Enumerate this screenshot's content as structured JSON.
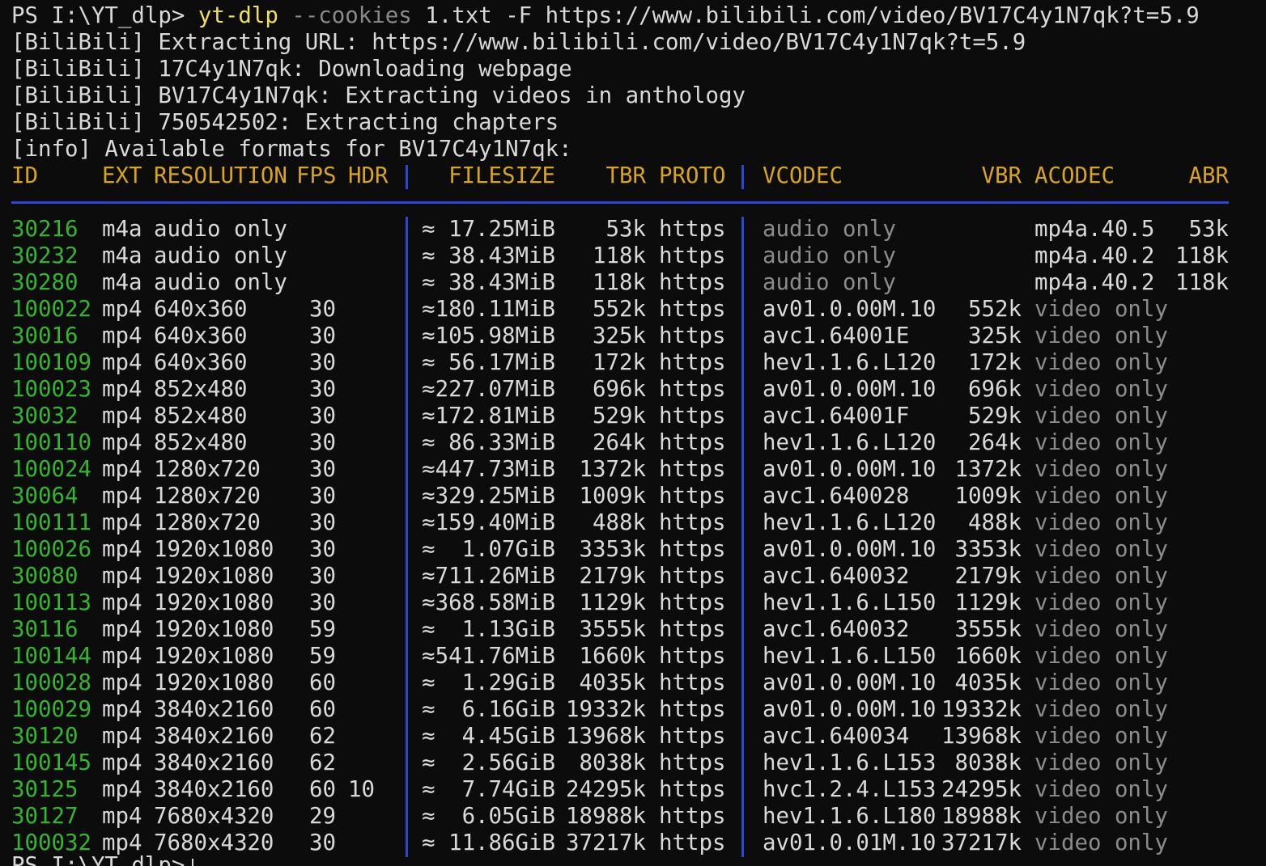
{
  "terminal": {
    "prompt": "PS I:\\YT_dlp> ",
    "command_name": "yt-dlp",
    "command_flag": "--cookies",
    "command_args": "1.txt -F https://www.bilibili.com/video/BV17C4y1N7qk?t=5.9",
    "log_lines": [
      "[BiliBili] Extracting URL: https://www.bilibili.com/video/BV17C4y1N7qk?t=5.9",
      "[BiliBili] 17C4y1N7qk: Downloading webpage",
      "[BiliBili] BV17C4y1N7qk: Extracting videos in anthology",
      "[BiliBili] 750542502: Extracting chapters",
      "[info] Available formats for BV17C4y1N7qk:"
    ],
    "next_prompt": "PS I:\\YT_dlp> "
  },
  "table": {
    "headers": {
      "id": "ID",
      "ext": "EXT",
      "res": "RESOLUTION",
      "fps": "FPS",
      "hdr": "HDR",
      "filesize": "FILESIZE",
      "tbr": "TBR",
      "proto": "PROTO",
      "vcodec": "VCODEC",
      "vbr": "VBR",
      "acodec": "ACODEC",
      "abr": "ABR"
    },
    "rows": [
      {
        "id": "30216",
        "ext": "m4a",
        "res": "audio only",
        "fps": "",
        "hdr": "",
        "size": "≈ 17.25MiB",
        "tbr": "53k",
        "proto": "https",
        "vcodec": "audio only",
        "vbr": "",
        "acodec": "mp4a.40.5",
        "abr": "53k"
      },
      {
        "id": "30232",
        "ext": "m4a",
        "res": "audio only",
        "fps": "",
        "hdr": "",
        "size": "≈ 38.43MiB",
        "tbr": "118k",
        "proto": "https",
        "vcodec": "audio only",
        "vbr": "",
        "acodec": "mp4a.40.2",
        "abr": "118k"
      },
      {
        "id": "30280",
        "ext": "m4a",
        "res": "audio only",
        "fps": "",
        "hdr": "",
        "size": "≈ 38.43MiB",
        "tbr": "118k",
        "proto": "https",
        "vcodec": "audio only",
        "vbr": "",
        "acodec": "mp4a.40.2",
        "abr": "118k"
      },
      {
        "id": "100022",
        "ext": "mp4",
        "res": "640x360",
        "fps": "30",
        "hdr": "",
        "size": "≈180.11MiB",
        "tbr": "552k",
        "proto": "https",
        "vcodec": "av01.0.00M.10",
        "vbr": "552k",
        "acodec": "video only",
        "abr": ""
      },
      {
        "id": "30016",
        "ext": "mp4",
        "res": "640x360",
        "fps": "30",
        "hdr": "",
        "size": "≈105.98MiB",
        "tbr": "325k",
        "proto": "https",
        "vcodec": "avc1.64001E",
        "vbr": "325k",
        "acodec": "video only",
        "abr": ""
      },
      {
        "id": "100109",
        "ext": "mp4",
        "res": "640x360",
        "fps": "30",
        "hdr": "",
        "size": "≈ 56.17MiB",
        "tbr": "172k",
        "proto": "https",
        "vcodec": "hev1.1.6.L120",
        "vbr": "172k",
        "acodec": "video only",
        "abr": ""
      },
      {
        "id": "100023",
        "ext": "mp4",
        "res": "852x480",
        "fps": "30",
        "hdr": "",
        "size": "≈227.07MiB",
        "tbr": "696k",
        "proto": "https",
        "vcodec": "av01.0.00M.10",
        "vbr": "696k",
        "acodec": "video only",
        "abr": ""
      },
      {
        "id": "30032",
        "ext": "mp4",
        "res": "852x480",
        "fps": "30",
        "hdr": "",
        "size": "≈172.81MiB",
        "tbr": "529k",
        "proto": "https",
        "vcodec": "avc1.64001F",
        "vbr": "529k",
        "acodec": "video only",
        "abr": ""
      },
      {
        "id": "100110",
        "ext": "mp4",
        "res": "852x480",
        "fps": "30",
        "hdr": "",
        "size": "≈ 86.33MiB",
        "tbr": "264k",
        "proto": "https",
        "vcodec": "hev1.1.6.L120",
        "vbr": "264k",
        "acodec": "video only",
        "abr": ""
      },
      {
        "id": "100024",
        "ext": "mp4",
        "res": "1280x720",
        "fps": "30",
        "hdr": "",
        "size": "≈447.73MiB",
        "tbr": "1372k",
        "proto": "https",
        "vcodec": "av01.0.00M.10",
        "vbr": "1372k",
        "acodec": "video only",
        "abr": ""
      },
      {
        "id": "30064",
        "ext": "mp4",
        "res": "1280x720",
        "fps": "30",
        "hdr": "",
        "size": "≈329.25MiB",
        "tbr": "1009k",
        "proto": "https",
        "vcodec": "avc1.640028",
        "vbr": "1009k",
        "acodec": "video only",
        "abr": ""
      },
      {
        "id": "100111",
        "ext": "mp4",
        "res": "1280x720",
        "fps": "30",
        "hdr": "",
        "size": "≈159.40MiB",
        "tbr": "488k",
        "proto": "https",
        "vcodec": "hev1.1.6.L120",
        "vbr": "488k",
        "acodec": "video only",
        "abr": ""
      },
      {
        "id": "100026",
        "ext": "mp4",
        "res": "1920x1080",
        "fps": "30",
        "hdr": "",
        "size": "≈  1.07GiB",
        "tbr": "3353k",
        "proto": "https",
        "vcodec": "av01.0.00M.10",
        "vbr": "3353k",
        "acodec": "video only",
        "abr": ""
      },
      {
        "id": "30080",
        "ext": "mp4",
        "res": "1920x1080",
        "fps": "30",
        "hdr": "",
        "size": "≈711.26MiB",
        "tbr": "2179k",
        "proto": "https",
        "vcodec": "avc1.640032",
        "vbr": "2179k",
        "acodec": "video only",
        "abr": ""
      },
      {
        "id": "100113",
        "ext": "mp4",
        "res": "1920x1080",
        "fps": "30",
        "hdr": "",
        "size": "≈368.58MiB",
        "tbr": "1129k",
        "proto": "https",
        "vcodec": "hev1.1.6.L150",
        "vbr": "1129k",
        "acodec": "video only",
        "abr": ""
      },
      {
        "id": "30116",
        "ext": "mp4",
        "res": "1920x1080",
        "fps": "59",
        "hdr": "",
        "size": "≈  1.13GiB",
        "tbr": "3555k",
        "proto": "https",
        "vcodec": "avc1.640032",
        "vbr": "3555k",
        "acodec": "video only",
        "abr": ""
      },
      {
        "id": "100144",
        "ext": "mp4",
        "res": "1920x1080",
        "fps": "59",
        "hdr": "",
        "size": "≈541.76MiB",
        "tbr": "1660k",
        "proto": "https",
        "vcodec": "hev1.1.6.L150",
        "vbr": "1660k",
        "acodec": "video only",
        "abr": ""
      },
      {
        "id": "100028",
        "ext": "mp4",
        "res": "1920x1080",
        "fps": "60",
        "hdr": "",
        "size": "≈  1.29GiB",
        "tbr": "4035k",
        "proto": "https",
        "vcodec": "av01.0.00M.10",
        "vbr": "4035k",
        "acodec": "video only",
        "abr": ""
      },
      {
        "id": "100029",
        "ext": "mp4",
        "res": "3840x2160",
        "fps": "60",
        "hdr": "",
        "size": "≈  6.16GiB",
        "tbr": "19332k",
        "proto": "https",
        "vcodec": "av01.0.00M.10",
        "vbr": "19332k",
        "acodec": "video only",
        "abr": ""
      },
      {
        "id": "30120",
        "ext": "mp4",
        "res": "3840x2160",
        "fps": "62",
        "hdr": "",
        "size": "≈  4.45GiB",
        "tbr": "13968k",
        "proto": "https",
        "vcodec": "avc1.640034",
        "vbr": "13968k",
        "acodec": "video only",
        "abr": ""
      },
      {
        "id": "100145",
        "ext": "mp4",
        "res": "3840x2160",
        "fps": "62",
        "hdr": "",
        "size": "≈  2.56GiB",
        "tbr": "8038k",
        "proto": "https",
        "vcodec": "hev1.1.6.L153",
        "vbr": "8038k",
        "acodec": "video only",
        "abr": ""
      },
      {
        "id": "30125",
        "ext": "mp4",
        "res": "3840x2160",
        "fps": "60",
        "hdr": "10",
        "size": "≈  7.74GiB",
        "tbr": "24295k",
        "proto": "https",
        "vcodec": "hvc1.2.4.L153",
        "vbr": "24295k",
        "acodec": "video only",
        "abr": ""
      },
      {
        "id": "30127",
        "ext": "mp4",
        "res": "7680x4320",
        "fps": "29",
        "hdr": "",
        "size": "≈  6.05GiB",
        "tbr": "18988k",
        "proto": "https",
        "vcodec": "hev1.1.6.L180",
        "vbr": "18988k",
        "acodec": "video only",
        "abr": ""
      },
      {
        "id": "100032",
        "ext": "mp4",
        "res": "7680x4320",
        "fps": "30",
        "hdr": "",
        "size": "≈ 11.86GiB",
        "tbr": "37217k",
        "proto": "https",
        "vcodec": "av01.0.01M.10",
        "vbr": "37217k",
        "acodec": "video only",
        "abr": ""
      }
    ]
  }
}
